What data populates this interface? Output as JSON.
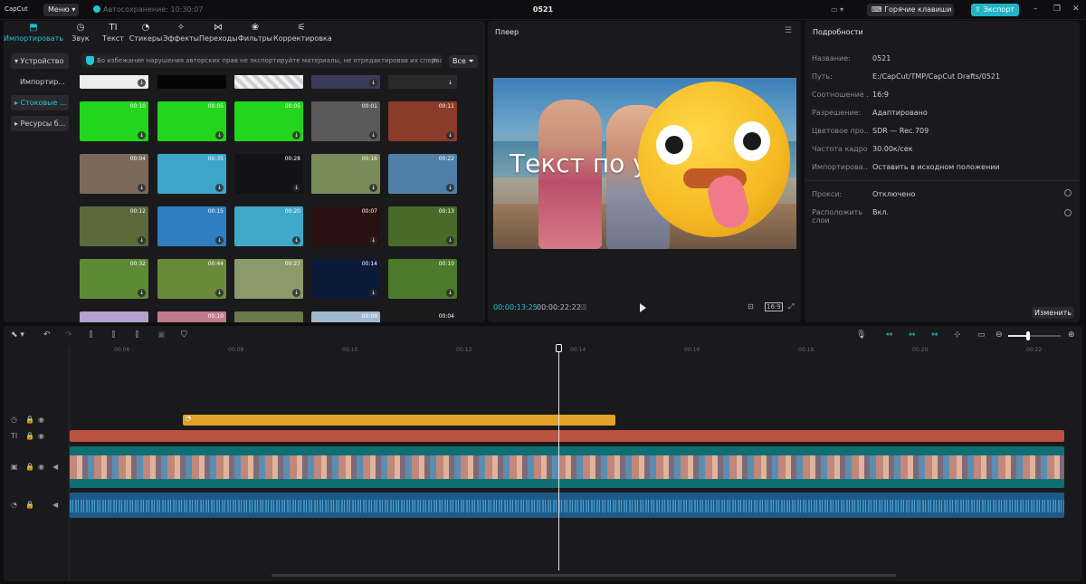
{
  "topbar": {
    "logo": "CapCut",
    "menu": "Меню",
    "autosave": "Автосохранение: 10:30:07",
    "project": "0521",
    "hotkeys": "Горячие клавиши",
    "export": "Экспорт"
  },
  "media": {
    "tabs": [
      {
        "label": "Импортировать",
        "icon": "⬒"
      },
      {
        "label": "Звук",
        "icon": "◷"
      },
      {
        "label": "Текст",
        "icon": "TI"
      },
      {
        "label": "Стикеры",
        "icon": "◔"
      },
      {
        "label": "Эффекты",
        "icon": "✧"
      },
      {
        "label": "Переходы",
        "icon": "⋈"
      },
      {
        "label": "Фильтры",
        "icon": "❀"
      },
      {
        "label": "Корректировка",
        "icon": "⚟"
      }
    ],
    "sidebar": [
      "▾ Устройство",
      "Импортир...",
      "▸ Стоковые ...",
      "▸ Ресурсы б..."
    ],
    "notice": "Во избежание нарушения авторских прав не экспортируйте материалы, не отредактировав их сперва в",
    "filter": "Все",
    "thumbs": [
      {
        "dur": "00:10",
        "color": "#22d51d"
      },
      {
        "dur": "00:05",
        "color": "#22d51d"
      },
      {
        "dur": "00:05",
        "color": "#22d51d"
      },
      {
        "dur": "00:01",
        "color": "#5a5a5a"
      },
      {
        "dur": "00:11",
        "color": "#8a3b2a"
      },
      {
        "dur": "00:04",
        "color": "#7b6a59"
      },
      {
        "dur": "00:35",
        "color": "#3da5c9"
      },
      {
        "dur": "00:28",
        "color": "#121218"
      },
      {
        "dur": "00:16",
        "color": "#7a8b5a"
      },
      {
        "dur": "00:22",
        "color": "#4f7fa6"
      },
      {
        "dur": "00:12",
        "color": "#5a6a3a"
      },
      {
        "dur": "00:15",
        "color": "#2e7fc2"
      },
      {
        "dur": "00:20",
        "color": "#3fa9c9"
      },
      {
        "dur": "00:07",
        "color": "#2a1010"
      },
      {
        "dur": "00:13",
        "color": "#4a6a2a"
      },
      {
        "dur": "00:32",
        "color": "#5c8a35"
      },
      {
        "dur": "00:44",
        "color": "#6a8a3a"
      },
      {
        "dur": "00:27",
        "color": "#8a9a6a"
      },
      {
        "dur": "00:14",
        "color": "#0c1a3a"
      },
      {
        "dur": "00:10",
        "color": "#4a7a2a"
      },
      {
        "dur": "",
        "color": "#b6a0d0"
      },
      {
        "dur": "00:10",
        "color": "#c07a8a"
      },
      {
        "dur": "",
        "color": "#6a7a4a"
      },
      {
        "dur": "00:09",
        "color": "#a0b8d0"
      },
      {
        "dur": "00:04",
        "color": "#1a1a1a"
      }
    ]
  },
  "player": {
    "title": "Плеер",
    "overlay_text": "Текст по у",
    "current": "00:00:13:25",
    "total": "00:00:22:22",
    "ratio": "16:9"
  },
  "details": {
    "title": "Подробности",
    "rows": [
      {
        "k": "Название:",
        "v": "0521"
      },
      {
        "k": "Путь:",
        "v": "E:/CapCut/TMP/CapCut Drafts/0521"
      },
      {
        "k": "Соотношение ...",
        "v": "16:9"
      },
      {
        "k": "Разрешение:",
        "v": "Адаптировано"
      },
      {
        "k": "Цветовое про...",
        "v": "SDR — Rec.709"
      },
      {
        "k": "Частота кадров:",
        "v": "30.00к/сек"
      },
      {
        "k": "Импортирова...",
        "v": "Оставить в исходном положении"
      }
    ],
    "proxy_k": "Прокси:",
    "proxy_v": "Отключено",
    "layers_k": "Расположить слои",
    "layers_v": "Вкл.",
    "edit": "Изменить"
  },
  "timeline": {
    "ticks": [
      "00:06",
      "00:08",
      "00:10",
      "00:12",
      "00:14",
      "00:16",
      "00:18",
      "00:20",
      "00:22"
    ]
  }
}
